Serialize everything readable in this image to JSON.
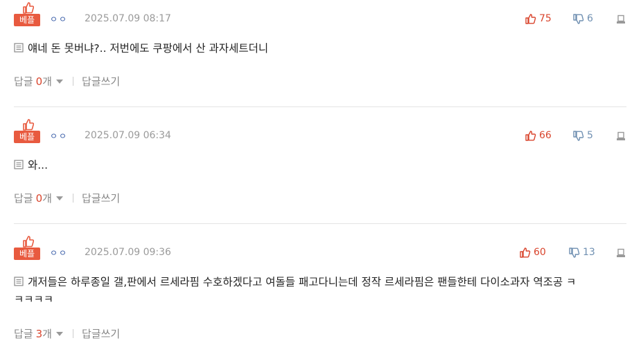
{
  "comments": [
    {
      "best_label": "베플",
      "nick": "ㅇㅇ",
      "date": "2025.07.09 08:17",
      "likes": "75",
      "dislikes": "6",
      "text": "얘네 돈 못버냐?.. 저번에도 쿠팡에서 산 과자세트더니",
      "text2": "",
      "reply_label": "답글",
      "reply_count": "0",
      "reply_unit": "개",
      "write_reply": "답글쓰기"
    },
    {
      "best_label": "베플",
      "nick": "ㅇㅇ",
      "date": "2025.07.09 06:34",
      "likes": "66",
      "dislikes": "5",
      "text": "와...",
      "text2": "",
      "reply_label": "답글",
      "reply_count": "0",
      "reply_unit": "개",
      "write_reply": "답글쓰기"
    },
    {
      "best_label": "베플",
      "nick": "ㅇㅇ",
      "date": "2025.07.09 09:36",
      "likes": "60",
      "dislikes": "13",
      "text": "개저들은 하루종일 갤,판에서 르세라핌 수호하겠다고 여돌들 패고다니는데 정작 르세라핌은 팬들한테 다이소과자 역조공 ㅋ",
      "text2": "ㅋㅋㅋㅋ",
      "reply_label": "답글",
      "reply_count": "3",
      "reply_unit": "개",
      "write_reply": "답글쓰기"
    }
  ],
  "colors": {
    "accent": "#e85a3f",
    "like": "#d9442c",
    "dislike": "#6f8fb1",
    "nick": "#3a5ea8"
  },
  "icons": [
    "thumbs-up-icon",
    "thumbs-down-icon",
    "report-icon",
    "document-icon",
    "caret-down-icon"
  ]
}
